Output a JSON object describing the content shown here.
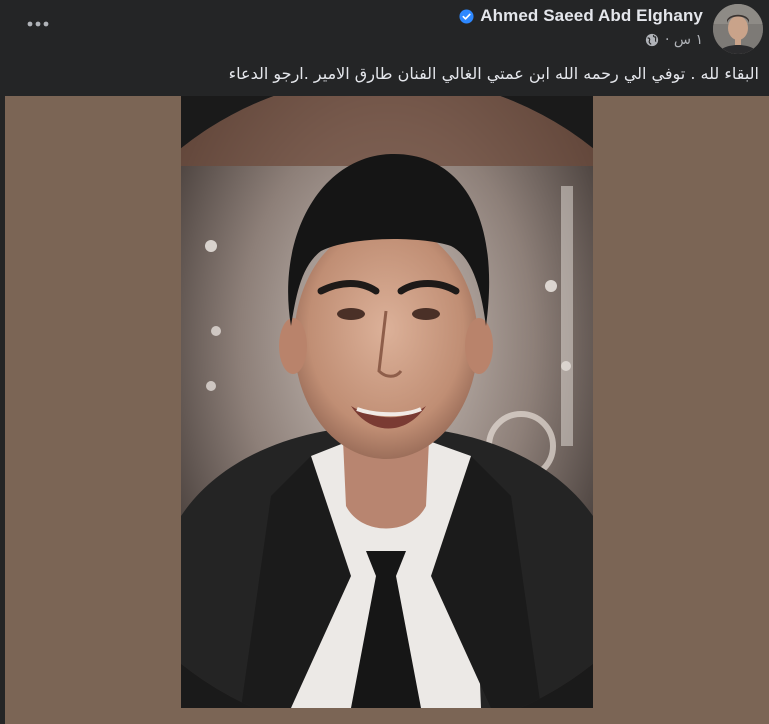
{
  "post": {
    "author": {
      "name": "Ahmed Saeed Abd Elghany",
      "verified": true
    },
    "timestamp": "١ س ·",
    "audience_icon": "globe-icon",
    "more_icon": "more-options-icon",
    "caption": "البقاء لله . توفي الي رحمه الله ابن عمتي الغالي الفنان طارق الامير .ارجو الدعاء",
    "colors": {
      "background": "#242526",
      "text_primary": "#e4e6eb",
      "text_secondary": "#b0b3b8",
      "verified_badge": "#2d88ff",
      "media_backdrop": "#7b6555"
    }
  }
}
